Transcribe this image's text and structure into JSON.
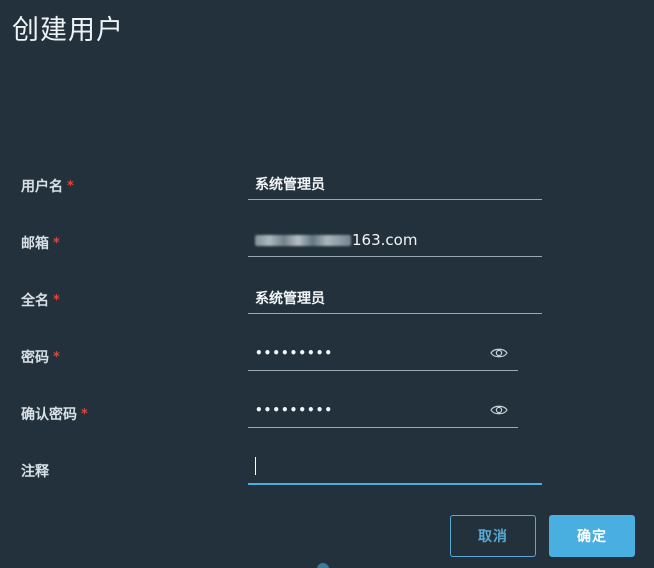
{
  "dialog": {
    "title": "创建用户"
  },
  "form": {
    "username": {
      "label": "用户名",
      "required": "*",
      "value": "系统管理员"
    },
    "email": {
      "label": "邮箱",
      "required": "*",
      "value_suffix": "163.com"
    },
    "fullname": {
      "label": "全名",
      "required": "*",
      "value": "系统管理员"
    },
    "password": {
      "label": "密码",
      "required": "*",
      "mask": "•••••••••",
      "icon": "eye-icon"
    },
    "confirm_password": {
      "label": "确认密码",
      "required": "*",
      "mask": "•••••••••",
      "icon": "eye-icon"
    },
    "comment": {
      "label": "注释",
      "value": ""
    }
  },
  "actions": {
    "cancel_label": "取消",
    "confirm_label": "确定"
  },
  "colors": {
    "background": "#22313b",
    "accent": "#49aee0",
    "required": "#e0463b"
  }
}
